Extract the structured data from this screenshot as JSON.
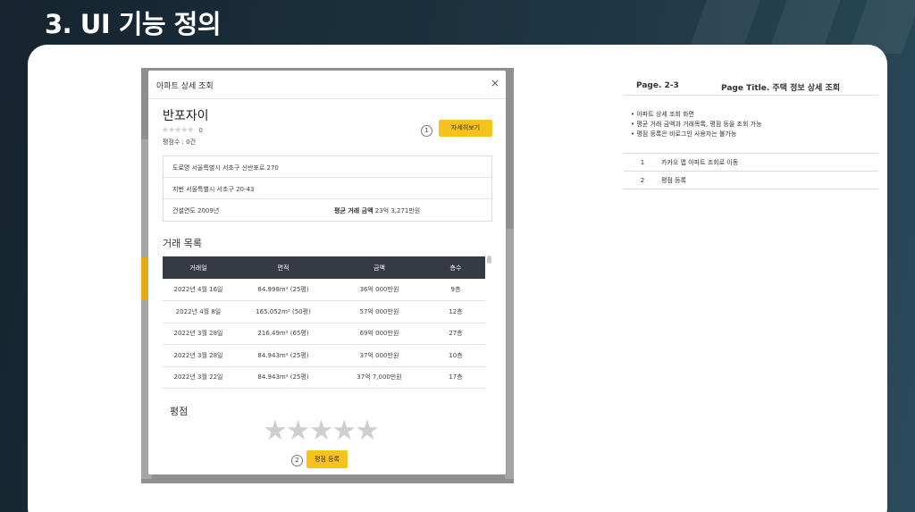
{
  "slide": {
    "title": "3. UI 기능 정의"
  },
  "modal": {
    "title": "아파트 상세 조회",
    "close_icon": "×",
    "apartment_name": "반포자이",
    "rating_stars": "★★★★★",
    "rating_value": "0",
    "rating_count": "평점수 : 0건",
    "marker1": "1",
    "detail_button": "자세히보기",
    "info": {
      "road_label": "도로명",
      "road_value": "서울특별시 서초구 신반포로 270",
      "lot_label": "지번",
      "lot_value": "서울특별시 서초구 20-43",
      "year_label": "건설연도",
      "year_value": "2009년",
      "avg_label": "평균 거래 금액",
      "avg_value": "23억 3,271만원"
    },
    "trade_title": "거래 목록",
    "table": {
      "headers": [
        "거래일",
        "면적",
        "금액",
        "층수"
      ],
      "rows": [
        [
          "2022년 4월 16일",
          "84.998m² (25평)",
          "36억 000만원",
          "9층"
        ],
        [
          "2022년 4월 8일",
          "165.052m² (50평)",
          "57억 000만원",
          "12층"
        ],
        [
          "2022년 3월 28일",
          "216.49m² (65평)",
          "69억 000만원",
          "27층"
        ],
        [
          "2022년 3월 28일",
          "84.943m² (25평)",
          "37억 000만원",
          "10층"
        ],
        [
          "2022년 3월 22일",
          "84.943m² (25평)",
          "37억 7,000만원",
          "17층"
        ]
      ]
    },
    "rating_title": "평점",
    "big_stars": "★★★★★",
    "marker2": "2",
    "rate_button": "평점 등록"
  },
  "description": {
    "page": "Page. 2-3",
    "page_title": "Page Title. 주택 정보 상세 조회",
    "bullets": [
      "아파트 상세 조회 화면",
      "평균 거래 금액과 거래목록, 평점 등을 조회 가능",
      "평점 등록은 비로그인 사용자는 불가능"
    ],
    "items": [
      {
        "num": "1",
        "text": "카카오 맵 아파트 조회로 이동"
      },
      {
        "num": "2",
        "text": "평점 등록"
      }
    ]
  },
  "colors": {
    "accent": "#f7c21b",
    "table_header": "#363b43",
    "slide_bg": "#1e3240"
  }
}
